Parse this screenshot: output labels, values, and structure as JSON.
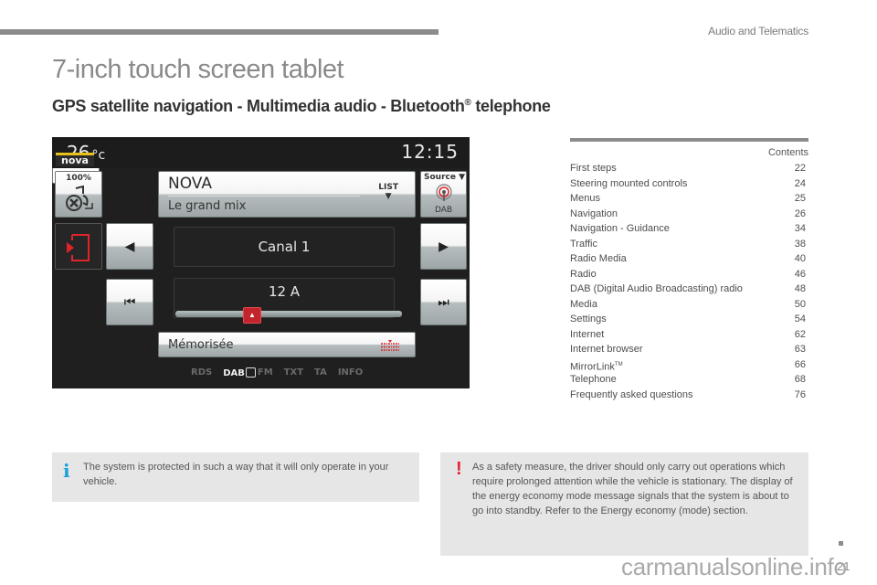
{
  "header": {
    "section_title": "Audio and Telematics",
    "page_title": "7-inch touch screen tablet",
    "subtitle_main": "GPS satellite navigation - Multimedia audio - Bluetooth",
    "subtitle_reg": "®",
    "subtitle_tail": " telephone"
  },
  "screen": {
    "temperature": "26",
    "temperature_unit": "°c",
    "clock": "12:15",
    "volume_percent": "100%",
    "station_logo": "nova",
    "station_name": "NOVA",
    "station_programme": "Le grand mix",
    "list_label": "LIST",
    "source_label": "Source ▼",
    "source_value": "DAB",
    "channel": "Canal 1",
    "frequency": "12 A",
    "memorised_label": "Mémorisée",
    "options": [
      {
        "label": "RDS",
        "active": false
      },
      {
        "label": "DAB",
        "active": true
      },
      {
        "label": "FM",
        "active": false
      },
      {
        "label": "TXT",
        "active": false
      },
      {
        "label": "TA",
        "active": false
      },
      {
        "label": "INFO",
        "active": false
      }
    ],
    "icons": {
      "prev": "◀",
      "next": "▶",
      "rewind": "⏮",
      "fast_forward": "⏭",
      "slider_thumb": "▲"
    }
  },
  "contents": {
    "heading": "Contents",
    "items": [
      {
        "label": "First steps",
        "page": "22"
      },
      {
        "label": "Steering mounted controls",
        "page": "24"
      },
      {
        "label": "Menus",
        "page": "25"
      },
      {
        "label": "Navigation",
        "page": "26"
      },
      {
        "label": "Navigation - Guidance",
        "page": "34"
      },
      {
        "label": "Traffic",
        "page": "38"
      },
      {
        "label": "Radio Media",
        "page": "40"
      },
      {
        "label": "Radio",
        "page": "46"
      },
      {
        "label": "DAB (Digital Audio Broadcasting) radio",
        "page": "48"
      },
      {
        "label": "Media",
        "page": "50"
      },
      {
        "label": "Settings",
        "page": "54"
      },
      {
        "label": "Internet",
        "page": "62"
      },
      {
        "label": "Internet browser",
        "page": "63"
      },
      {
        "label": "MirrorLink™",
        "page": "66"
      },
      {
        "label": "Telephone",
        "page": "68"
      },
      {
        "label": "Frequently asked questions",
        "page": "76"
      }
    ]
  },
  "notes": {
    "info_icon": "i",
    "info_text": "The system is protected in such a way that it will only operate in your vehicle.",
    "warning_icon": "!",
    "warning_text": "As a safety measure, the driver should only carry out operations which require prolonged attention while the vehicle is stationary. The display of the energy economy mode message signals that the system is about to go into standby. Refer to the Energy economy (mode) section."
  },
  "footer": {
    "page_number": "21",
    "watermark": "carmanualsonline.info"
  },
  "colors": {
    "accent_red": "#c3242b",
    "info_blue": "#1a9fd9",
    "note_bg": "#e6e6e7",
    "rule_gray": "#8c8c8c"
  }
}
